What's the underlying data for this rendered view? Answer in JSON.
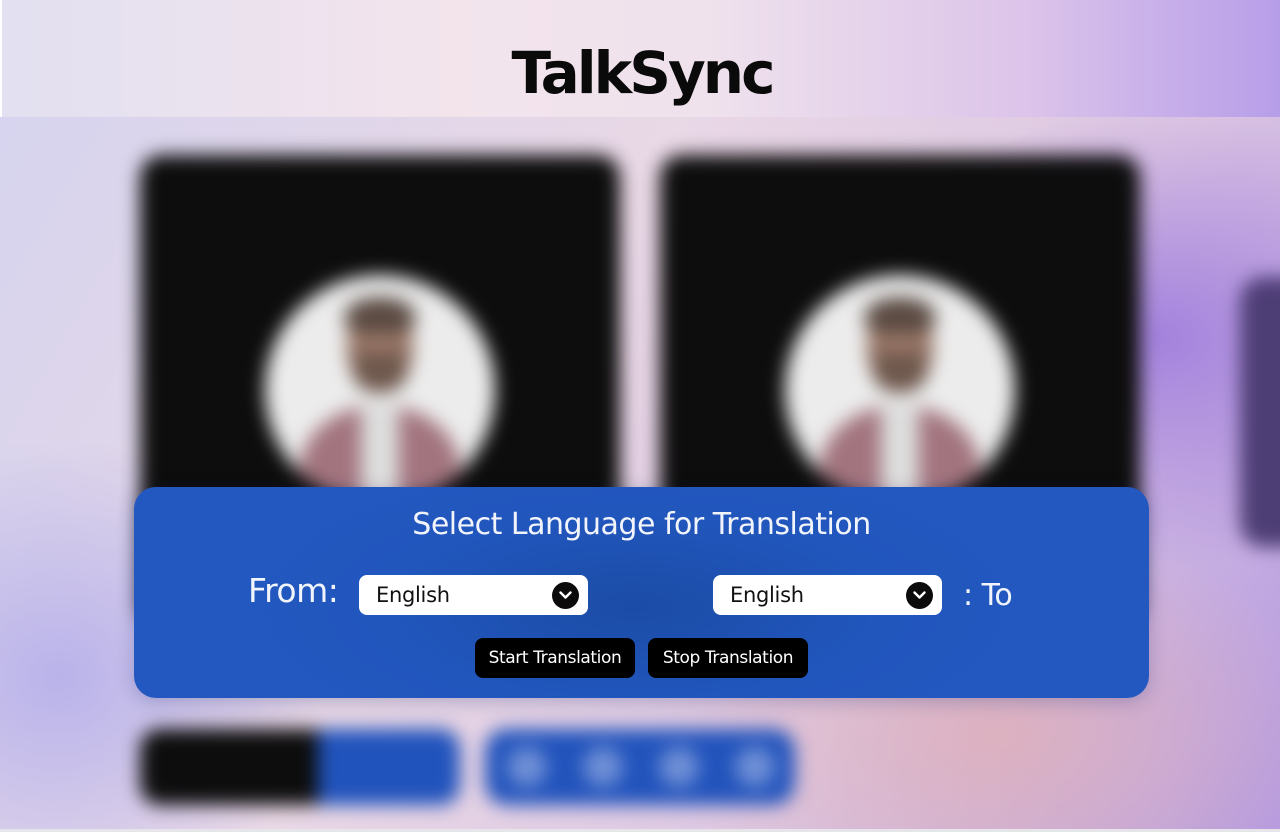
{
  "app": {
    "title": "TalkSync"
  },
  "translation_panel": {
    "heading": "Select Language for Translation",
    "from_label": "From:",
    "to_label": ": To",
    "from_select": {
      "selected": "English"
    },
    "to_select": {
      "selected": "English"
    },
    "start_button_label": "Start Translation",
    "stop_button_label": "Stop Translation"
  },
  "background": {
    "video_tiles": [
      "participant-video-left",
      "participant-video-right"
    ],
    "call_controls_count": 4
  },
  "colors": {
    "panel_blue": "#2156bd",
    "button_black": "#000000",
    "text_light": "#f2f4fb"
  },
  "icons": {
    "select_chevron": "chevron-down-icon"
  }
}
